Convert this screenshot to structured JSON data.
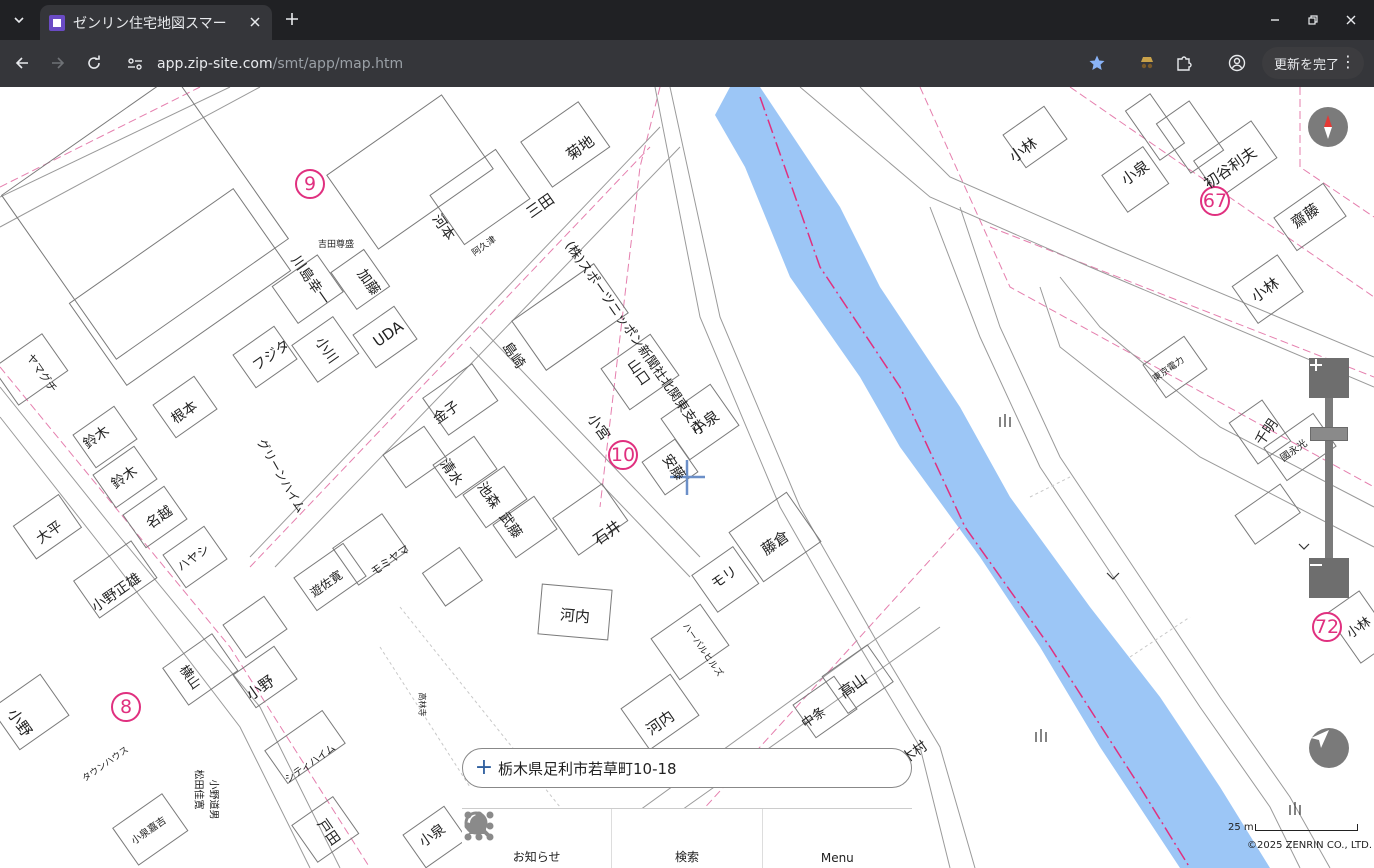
{
  "browser": {
    "tab_title": "ゼンリン住宅地図スマー",
    "url_host": "app.zip-site.com",
    "url_path": "/smt/app/map.htm",
    "update_label": "更新を完了"
  },
  "map": {
    "circle_markers": [
      "9",
      "10",
      "67",
      "8",
      "72"
    ],
    "labels": [
      {
        "text": "小林"
      },
      {
        "text": "小泉"
      },
      {
        "text": "初谷利夫"
      },
      {
        "text": "齋藤"
      },
      {
        "text": "小林"
      },
      {
        "text": "東京電力"
      },
      {
        "text": "千明"
      },
      {
        "text": "國永光"
      },
      {
        "text": "小林"
      },
      {
        "text": "菊地"
      },
      {
        "text": "三田"
      },
      {
        "text": "阿久津"
      },
      {
        "text": "河本"
      },
      {
        "text": "(株)スポーツニッポン新聞社北関東支社"
      },
      {
        "text": "吉田尊盛"
      },
      {
        "text": "川島幸一"
      },
      {
        "text": "加藤"
      },
      {
        "text": "UDA"
      },
      {
        "text": "フジタ"
      },
      {
        "text": "小川"
      },
      {
        "text": "島崎"
      },
      {
        "text": "山口"
      },
      {
        "text": "小泉"
      },
      {
        "text": "小宮"
      },
      {
        "text": "金子"
      },
      {
        "text": "安藤"
      },
      {
        "text": "ヤマグチ"
      },
      {
        "text": "根本"
      },
      {
        "text": "グリーンハイム"
      },
      {
        "text": "鈴木"
      },
      {
        "text": "鈴木"
      },
      {
        "text": "名越"
      },
      {
        "text": "大平"
      },
      {
        "text": "清水"
      },
      {
        "text": "池森"
      },
      {
        "text": "武藤"
      },
      {
        "text": "石井"
      },
      {
        "text": "藤倉"
      },
      {
        "text": "モリ"
      },
      {
        "text": "ハヤシ"
      },
      {
        "text": "小野正雄"
      },
      {
        "text": "モミヤマ"
      },
      {
        "text": "遊佐寛"
      },
      {
        "text": "河内"
      },
      {
        "text": "ハーバルヒルズ"
      },
      {
        "text": "高山"
      },
      {
        "text": "中条"
      },
      {
        "text": "河内"
      },
      {
        "text": "松田佳寛"
      },
      {
        "text": "小野道男"
      },
      {
        "text": "小野"
      },
      {
        "text": "小野"
      },
      {
        "text": "タウンハウス"
      },
      {
        "text": "シティハイム"
      },
      {
        "text": "木村"
      },
      {
        "text": "小泉"
      },
      {
        "text": "横山"
      },
      {
        "text": "戸田"
      },
      {
        "text": "小泉嘉吉"
      },
      {
        "text": "高林寺"
      }
    ]
  },
  "address": {
    "text": "栃木県足利市若草町10-18"
  },
  "bottom_nav": [
    {
      "label": "お知らせ",
      "icon": "bell-icon"
    },
    {
      "label": "検索",
      "icon": "search-icon"
    },
    {
      "label": "Menu",
      "icon": "grid-icon"
    }
  ],
  "scale": {
    "label": "25 m"
  },
  "copyright": "©2025 ZENRIN CO., LTD.",
  "colors": {
    "river": "#9cc6f6",
    "boundary": "#e0307f",
    "chrome_dark": "#202124",
    "chrome_toolbar": "#35363a"
  }
}
